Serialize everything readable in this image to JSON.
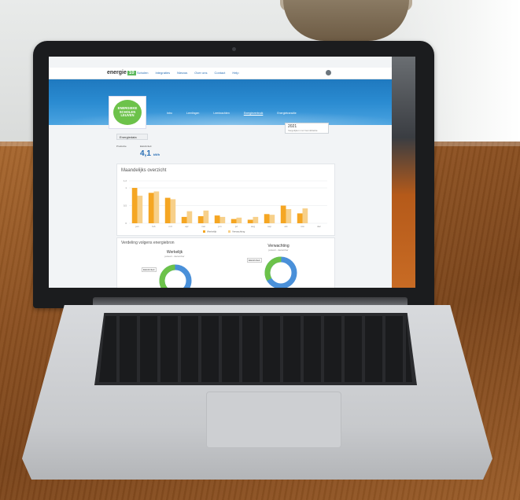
{
  "app": {
    "logo_text": "energie",
    "logo_badge": "10",
    "nav_items": [
      "Scholen",
      "Integraties",
      "Nieuws",
      "Over ons",
      "Contact",
      "Help"
    ]
  },
  "badge": {
    "line1": "ENERGIEKE",
    "line2": "SCHOLEN",
    "line3": "LEUVEN"
  },
  "subtabs": [
    "Intro",
    "Leerlingen",
    "Leerkrachten",
    "Energieverbruik",
    "Energietransitie"
  ],
  "year_select": {
    "value": "2021",
    "sub": "Vergelijken met Gemiddelde"
  },
  "page": {
    "dropdown_label": "Energiedata",
    "stat_label_1": "Productie",
    "stat_label_2": "Elektriciteit",
    "big_value": "4,1",
    "big_unit": "kWh",
    "chart_title": "Maandelijks overzicht",
    "dist_title": "Verdeling volgens energiebron",
    "donut1_title": "Werkelijk",
    "donut1_sub": "januari - december",
    "donut2_title": "Verwachting",
    "donut2_sub": "januari - december",
    "donut_tag": "Elektriciteit"
  },
  "colors": {
    "accent": "#2a6fb5",
    "series1": "#f5a623",
    "series2": "#f7d08a",
    "donut_a": "#4a90d9",
    "donut_b": "#6cc24a"
  },
  "chart_data": {
    "type": "bar",
    "categories": [
      "jan",
      "feb",
      "mrt",
      "apr",
      "mei",
      "jun",
      "jul",
      "aug",
      "sep",
      "okt",
      "nov",
      "dec"
    ],
    "series": [
      {
        "name": "Werkelijk",
        "values": [
          1.0,
          0.86,
          0.72,
          0.18,
          0.2,
          0.22,
          0.12,
          0.1,
          0.26,
          0.5,
          0.28,
          0.0
        ]
      },
      {
        "name": "Verwachting",
        "values": [
          0.78,
          0.9,
          0.68,
          0.34,
          0.36,
          0.18,
          0.16,
          0.18,
          0.24,
          0.4,
          0.42,
          0.0
        ]
      }
    ],
    "ylim": [
      0,
      1.2
    ],
    "yticks": [
      "0",
      "0,5",
      "1",
      "1,2"
    ],
    "legend": "bottom"
  }
}
